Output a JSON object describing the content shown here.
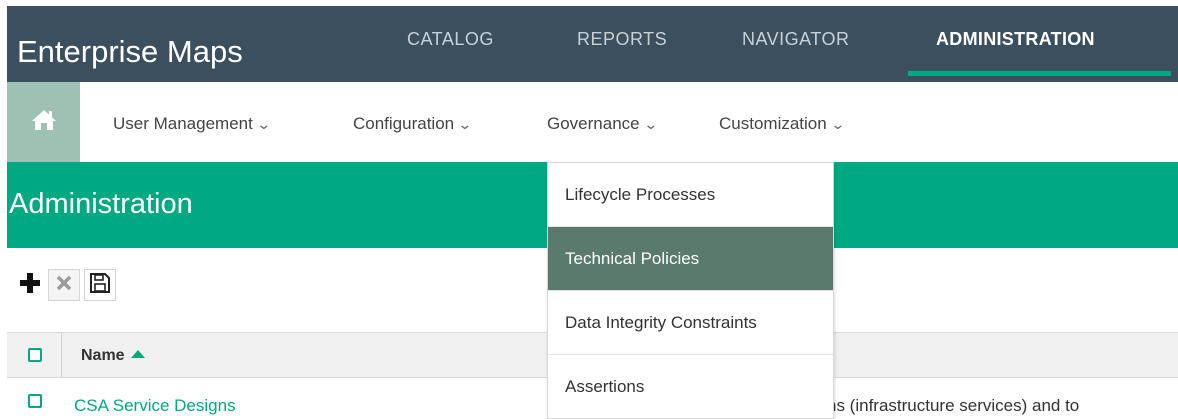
{
  "app": {
    "title": "Enterprise Maps"
  },
  "nav": {
    "tabs": [
      {
        "label": "CATALOG",
        "active": false
      },
      {
        "label": "REPORTS",
        "active": false
      },
      {
        "label": "NAVIGATOR",
        "active": false
      },
      {
        "label": "ADMINISTRATION",
        "active": true
      }
    ]
  },
  "subnav": {
    "home_icon": "home-icon",
    "items": [
      {
        "label": "User Management"
      },
      {
        "label": "Configuration"
      },
      {
        "label": "Governance",
        "open": true
      },
      {
        "label": "Customization"
      }
    ]
  },
  "page": {
    "title": "Administration"
  },
  "toolbar": {
    "buttons": [
      {
        "icon": "plus-icon",
        "enabled": true
      },
      {
        "icon": "delete-x-icon",
        "enabled": false
      },
      {
        "icon": "save-disk-icon",
        "enabled": true
      }
    ]
  },
  "table": {
    "columns": [
      {
        "label": "Name",
        "sort": "ascending"
      }
    ],
    "rows": [
      {
        "name": "CSA Service Designs",
        "description_fragment": "ns (infrastructure services) and to"
      }
    ]
  },
  "governance_menu": {
    "items": [
      {
        "label": "Lifecycle Processes"
      },
      {
        "label": "Technical Policies",
        "highlighted": true
      },
      {
        "label": "Data Integrity Constraints"
      },
      {
        "label": "Assertions"
      }
    ]
  },
  "colors": {
    "header_dark": "#3c4f5e",
    "accent_green": "#00a982",
    "menu_highlight": "#5b7a6e",
    "home_button": "#9fc1b4"
  }
}
